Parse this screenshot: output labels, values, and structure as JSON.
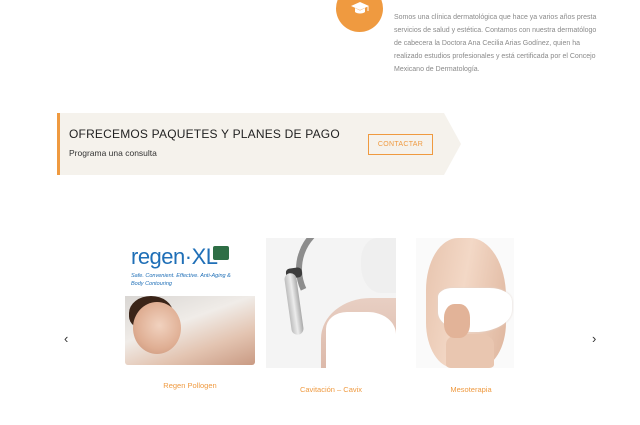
{
  "about": {
    "icon": "graduation-cap-icon",
    "text": "Somos una clínica dermatológica que hace ya varios años presta servicios de salud y estética. Contamos con nuestra dermatólogo de cabecera la Doctora Ana Cecilia Arias Godínez, quien ha realizado estudios profesionales y está certificada por el Concejo Mexicano de Dermatología."
  },
  "cta": {
    "title": "OFRECEMOS PAQUETES Y PLANES DE PAGO",
    "subtitle": "Programa una consulta",
    "button_label": "CONTACTAR"
  },
  "carousel": {
    "prev": "‹",
    "next": "›",
    "items": [
      {
        "label": "Regen Pollogen",
        "logo_text": "regen·XL",
        "tagline": "Safe. Convenient. Effective. Anti-Aging & Body Contouring"
      },
      {
        "label": "Cavitación – Cavix"
      },
      {
        "label": "Mesoterapia"
      }
    ]
  },
  "colors": {
    "accent": "#ef9a40",
    "band": "#f5f2ec",
    "text_muted": "#8a8a8a"
  }
}
